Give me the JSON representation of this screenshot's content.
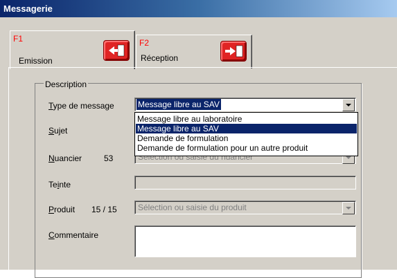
{
  "window": {
    "title": "Messagerie"
  },
  "tabs": [
    {
      "key": "F1",
      "label": "Emission",
      "icon": "mail-send-icon"
    },
    {
      "key": "F2",
      "label": "Réception",
      "icon": "mail-receive-icon"
    }
  ],
  "description": {
    "legend": "Description",
    "type_message": {
      "label_underlined": "T",
      "label_rest": "ype de message",
      "value": "Message libre au SAV",
      "options": [
        "Message libre au laboratoire",
        "Message libre au SAV",
        "Demande de formulation",
        "Demande de formulation pour un autre produit"
      ],
      "selected_index": 1
    },
    "sujet": {
      "label_underlined": "S",
      "label_rest": "ujet"
    },
    "nuancier": {
      "label_underlined": "N",
      "label_rest": "uancier",
      "count": "53",
      "placeholder": "Sélection ou saisie du nuancier"
    },
    "teinte": {
      "label_pre": "Te",
      "label_underlined": "i",
      "label_rest": "nte"
    },
    "produit": {
      "label_underlined": "P",
      "label_rest": "roduit",
      "count": "15 / 15",
      "placeholder": "Sélection ou saisie du produit"
    },
    "commentaire": {
      "label_underlined": "C",
      "label_rest": "ommentaire"
    }
  },
  "colors": {
    "accent": "#0a246a",
    "fkey": "#ff0000",
    "icon": "#e02424"
  }
}
